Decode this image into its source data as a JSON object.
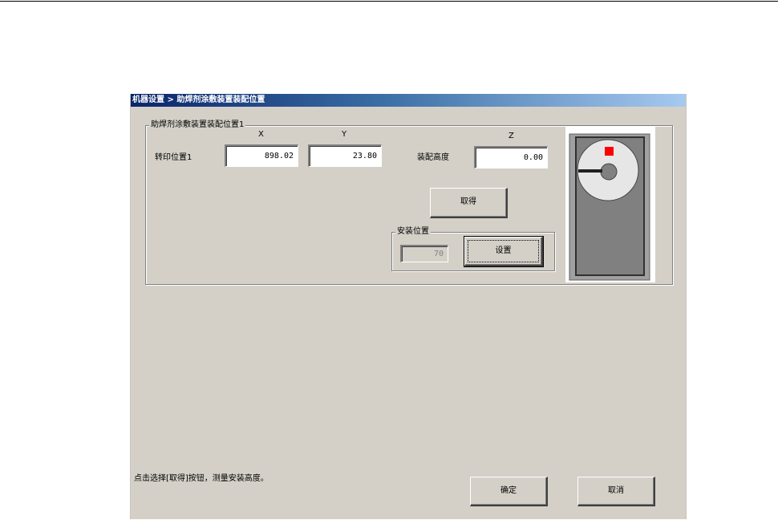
{
  "window": {
    "title": "机器设置 > 助焊剂涂敷装置装配位置"
  },
  "assembly_group": {
    "title": "助焊剂涂敷装置装配位置1",
    "col_x": "X",
    "col_y": "Y",
    "col_z": "Z",
    "row_label": "转印位置1",
    "x_value": "898.02",
    "y_value": "23.80",
    "height_label": "装配高度",
    "z_value": "0.00",
    "acquire_button": "取得"
  },
  "install_group": {
    "title": "安装位置",
    "value": "70",
    "set_button": "设置"
  },
  "preview": {
    "icon": "flux-unit-diagram",
    "marker_color": "#ff0000"
  },
  "footer": {
    "hint": "点击选择[取得]按钮，测量安装高度。",
    "ok_button": "确定",
    "cancel_button": "取消"
  }
}
